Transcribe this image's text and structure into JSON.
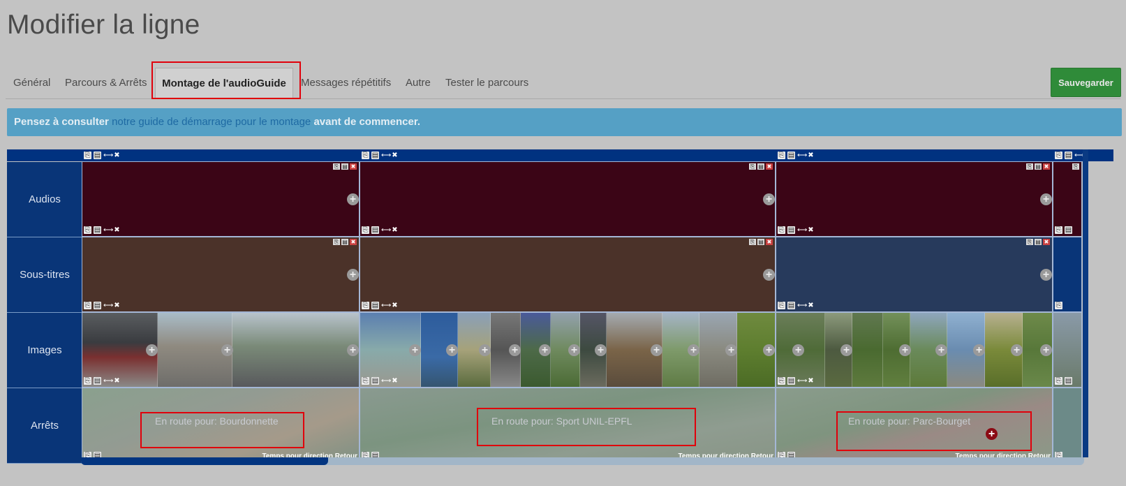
{
  "page": {
    "title": "Modifier la ligne"
  },
  "tabs": [
    {
      "label": "Général"
    },
    {
      "label": "Parcours & Arrêts"
    },
    {
      "label": "Montage de l'audioGuide"
    },
    {
      "label": "Messages répétitifs"
    },
    {
      "label": "Autre"
    },
    {
      "label": "Tester le parcours"
    }
  ],
  "toolbar": {
    "save_label": "Sauvegarder"
  },
  "alert": {
    "prefix": "Pensez à consulter",
    "link": "notre guide de démarrage pour le montage",
    "suffix": "avant de commencer."
  },
  "rows": {
    "audios": "Audios",
    "subtitles": "Sous-titres",
    "images": "Images",
    "stops": "Arrêts"
  },
  "segments": [
    {
      "stop": "En route pour: Bourdonnette",
      "time": "Temps pour direction Retour"
    },
    {
      "stop": "En route pour: Sport UNIL-EPFL",
      "time": "Temps pour direction Retour"
    },
    {
      "stop": "En route pour: Parc-Bourget",
      "time": "Temps pour direction Retour"
    }
  ],
  "colors": {
    "background": "#c3c3c3",
    "row_label": "#093578",
    "audio": "#3b0516",
    "subtitle_brown": "#4b3229",
    "subtitle_blue": "#273a5c",
    "save_button": "#2f8b39",
    "alert": "#55a0c5",
    "highlight": "#e0000b"
  },
  "icons": [
    "copy-icon",
    "paste-icon",
    "resize-icon",
    "delete-icon",
    "plus-icon"
  ]
}
